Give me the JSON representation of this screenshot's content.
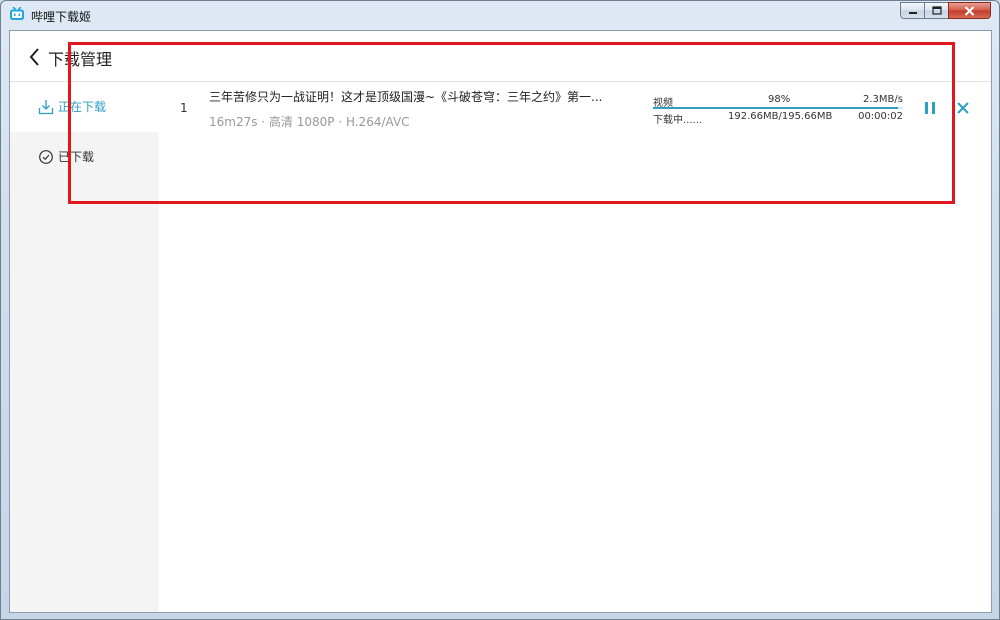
{
  "window": {
    "title": "哔哩下载姬",
    "controls": [
      "minimize-icon",
      "maximize-icon",
      "close-icon"
    ]
  },
  "header": {
    "title": "下载管理",
    "back_icon": "chevron-left-icon"
  },
  "sidebar": {
    "items": [
      {
        "label": "正在下载",
        "icon": "download-icon",
        "active": true
      },
      {
        "label": "已下载",
        "icon": "check-circle-icon",
        "active": false
      }
    ]
  },
  "downloads": [
    {
      "index": "1",
      "title": "三年苦修只为一战证明！这才是顶级国漫~《斗破苍穹：三年之约》第一...",
      "meta": "16m27s · 高清 1080P · H.264/AVC",
      "type": "视频",
      "percent_text": "98%",
      "progress": 0.98,
      "speed": "2.3MB/s",
      "status": "下载中......",
      "size": "192.66MB/195.66MB",
      "remaining": "00:00:02"
    }
  ],
  "colors": {
    "accent": "#2f9ec5",
    "highlight": "#e2161d"
  }
}
